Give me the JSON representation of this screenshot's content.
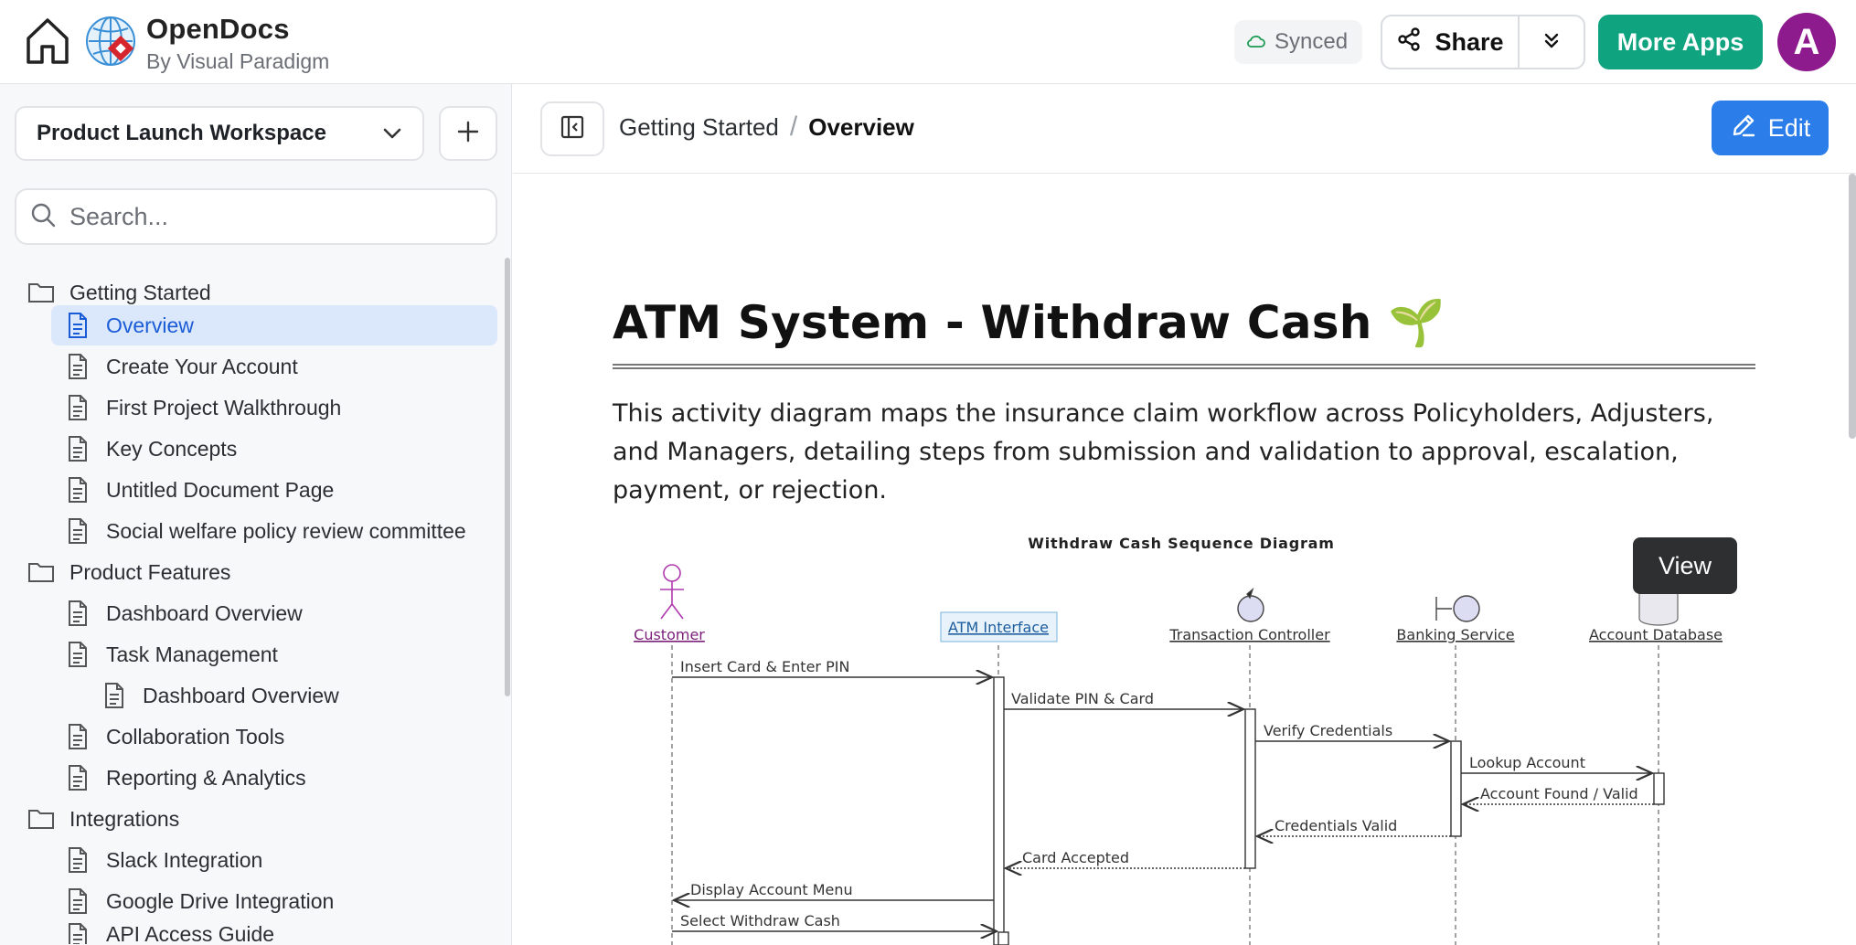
{
  "app": {
    "name": "OpenDocs",
    "byline": "By Visual Paradigm",
    "sync_status": "Synced",
    "share_label": "Share",
    "more_apps_label": "More Apps",
    "avatar_letter": "A",
    "colors": {
      "more_apps": "#10a37f",
      "edit": "#2b7de9",
      "avatar": "#8e1b8e",
      "active_item_bg": "#dbe7fb",
      "active_item_text": "#1a5cd6"
    }
  },
  "sidebar": {
    "workspace": "Product Launch Workspace",
    "search_placeholder": "Search...",
    "tree": [
      {
        "type": "folder",
        "label": "Getting Started"
      },
      {
        "type": "page",
        "label": "Overview",
        "active": true
      },
      {
        "type": "page",
        "label": "Create Your Account"
      },
      {
        "type": "page",
        "label": "First Project Walkthrough"
      },
      {
        "type": "page",
        "label": "Key Concepts"
      },
      {
        "type": "page",
        "label": "Untitled Document Page"
      },
      {
        "type": "page",
        "label": "Social welfare policy review committee"
      },
      {
        "type": "folder",
        "label": "Product Features"
      },
      {
        "type": "page",
        "label": "Dashboard Overview"
      },
      {
        "type": "page",
        "label": "Task Management"
      },
      {
        "type": "page",
        "label": "Dashboard Overview"
      },
      {
        "type": "page",
        "label": "Collaboration Tools"
      },
      {
        "type": "page",
        "label": "Reporting & Analytics"
      },
      {
        "type": "folder",
        "label": "Integrations"
      },
      {
        "type": "page",
        "label": "Slack Integration"
      },
      {
        "type": "page",
        "label": "Google Drive Integration"
      },
      {
        "type": "page",
        "label": "API Access Guide"
      }
    ]
  },
  "breadcrumb": {
    "root": "Getting Started",
    "separator": "/",
    "current": "Overview"
  },
  "toolbar": {
    "edit_label": "Edit"
  },
  "document": {
    "title": "ATM System - Withdraw Cash",
    "title_emoji": "🌱",
    "description": "This activity diagram maps the insurance claim workflow across Policyholders, Adjusters, and Managers, detailing steps from submission and validation to approval, escalation, payment, or rejection.",
    "view_tooltip": "View"
  },
  "diagram": {
    "title": "Withdraw Cash Sequence Diagram",
    "lifelines": [
      "Customer",
      "ATM Interface",
      "Transaction Controller",
      "Banking Service",
      "Account Database"
    ],
    "messages": [
      {
        "label": "Insert Card & Enter PIN",
        "dashed": false
      },
      {
        "label": "Validate PIN & Card",
        "dashed": false
      },
      {
        "label": "Verify Credentials",
        "dashed": false
      },
      {
        "label": "Lookup Account",
        "dashed": false
      },
      {
        "label": "Account Found / Valid",
        "dashed": true
      },
      {
        "label": "Credentials Valid",
        "dashed": true
      },
      {
        "label": "Card Accepted",
        "dashed": true
      },
      {
        "label": "Display Account Menu",
        "dashed": false
      },
      {
        "label": "Select Withdraw Cash",
        "dashed": false
      }
    ]
  }
}
